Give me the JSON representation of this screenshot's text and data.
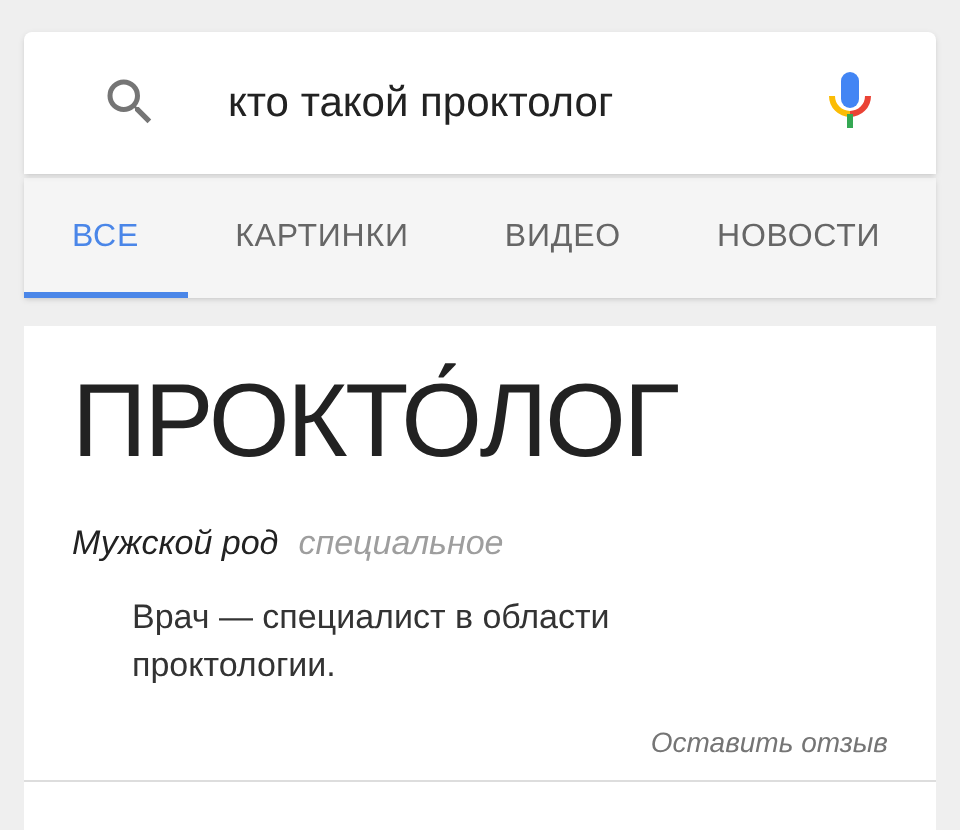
{
  "search": {
    "value": "кто такой проктолог"
  },
  "tabs": [
    {
      "label": "ВСЕ",
      "selected": true
    },
    {
      "label": "КАРТИНКИ",
      "selected": false
    },
    {
      "label": "ВИДЕО",
      "selected": false
    },
    {
      "label": "НОВОСТИ",
      "selected": false
    }
  ],
  "definition": {
    "word": "ПРОКТО́ЛОГ",
    "gender": "Мужской род",
    "register": "специальное",
    "meaning": "Врач — специалист в области проктологии.",
    "feedback_link": "Оставить отзыв"
  }
}
